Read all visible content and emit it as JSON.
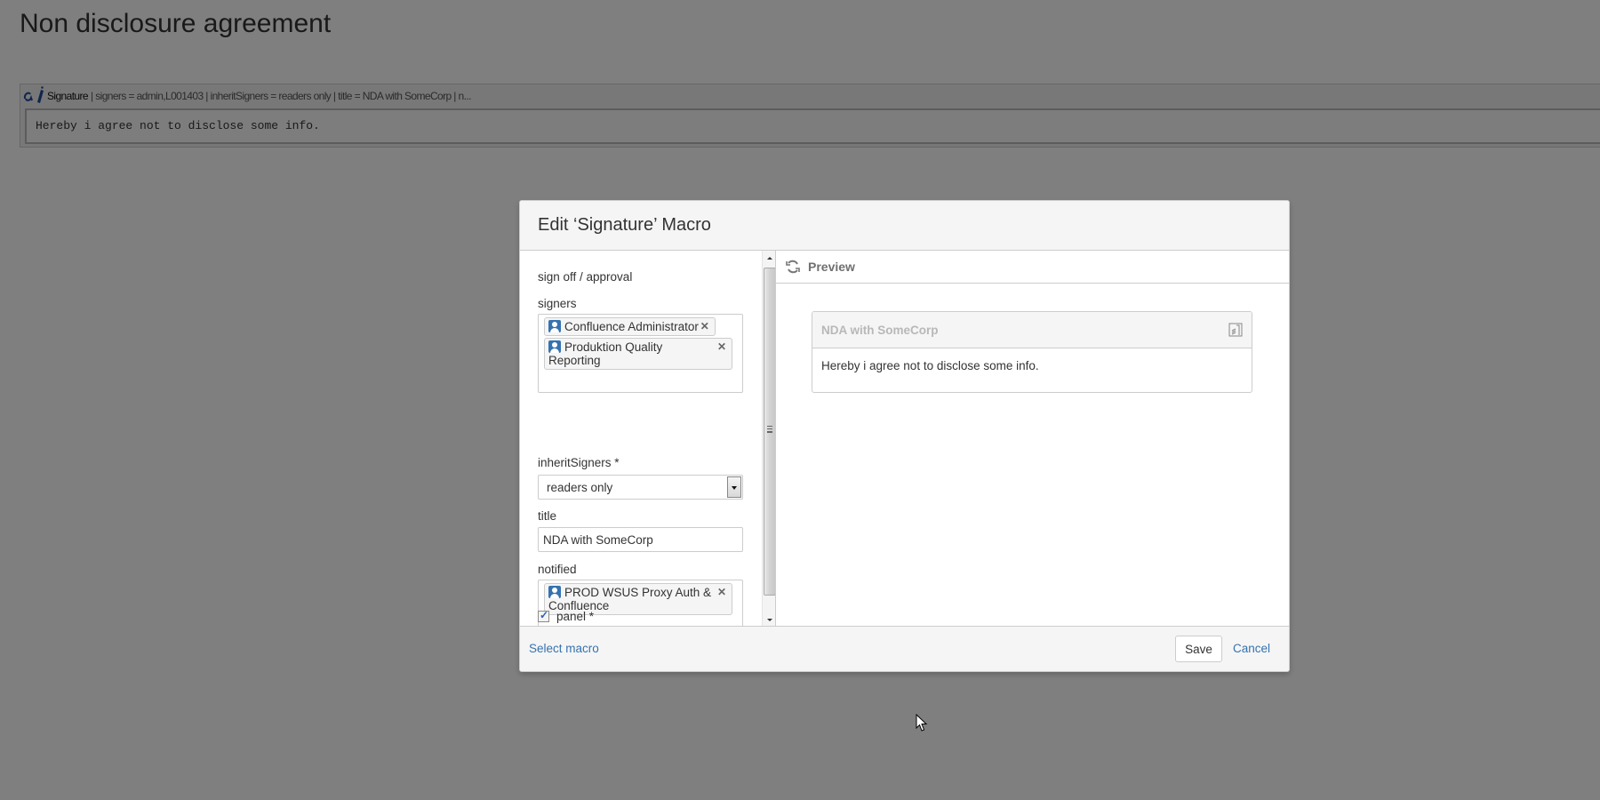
{
  "page": {
    "title": "Non disclosure agreement",
    "macro_placeholder": {
      "icon": "signature-pen-icon",
      "name": "Signature",
      "params_summary": "| signers = admin,L001403 | inheritSigners = readers only | title = NDA with SomeCorp | n...",
      "body_text": "Hereby i agree not to disclose some info."
    }
  },
  "dialog": {
    "title": "Edit ‘Signature’ Macro",
    "form": {
      "category": "sign off / approval",
      "signers": {
        "label": "signers",
        "tokens": [
          {
            "icon": "user-icon",
            "label": "Confluence Administrator"
          },
          {
            "icon": "user-icon",
            "label": "Produktion Quality Reporting"
          }
        ]
      },
      "inherit_signers": {
        "label": "inheritSigners *",
        "selected": "readers only"
      },
      "title": {
        "label": "title",
        "value": "NDA with SomeCorp"
      },
      "notified": {
        "label": "notified",
        "tokens": [
          {
            "icon": "user-icon",
            "label": "PROD WSUS Proxy Auth & Confluence"
          }
        ]
      },
      "panel": {
        "label": "panel *",
        "checked": true
      }
    },
    "preview": {
      "label": "Preview",
      "panel_title": "NDA with SomeCorp",
      "panel_body": "Hereby i agree not to disclose some info."
    },
    "footer": {
      "select_macro": "Select macro",
      "save": "Save",
      "cancel": "Cancel"
    }
  },
  "colors": {
    "link": "#3572b0",
    "overlay": "rgba(0,0,0,0.5)",
    "user_icon": "#3572b0"
  }
}
